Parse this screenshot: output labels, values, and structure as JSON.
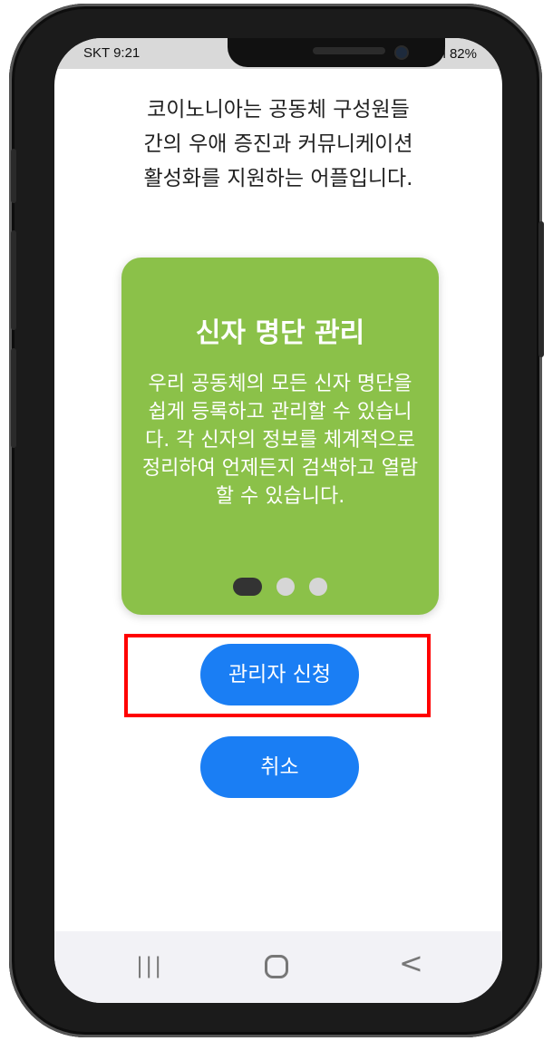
{
  "status_bar": {
    "left": "SKT 9:21",
    "right": "⇄.ıl 82%"
  },
  "intro_text": "코이노니아는 공동체 구성원들\n간의 우애 증진과 커뮤니케이션\n활성화를 지원하는 어플입니다.",
  "card": {
    "title": "신자 명단 관리",
    "text": "우리 공동체의 모든 신자 명단을 쉽게 등록하고 관리할 수 있습니다. 각 신자의 정보를 체계적으로 정리하여 언제든지 검색하고 열람할 수 있습니다.",
    "background_color": "#8bc149",
    "active_dot": 1,
    "dot_count": 3
  },
  "buttons": {
    "apply": "관리자 신청",
    "cancel": "취소",
    "color": "#1a7ef4"
  },
  "nav": {
    "recent": "|||",
    "back": "<"
  }
}
